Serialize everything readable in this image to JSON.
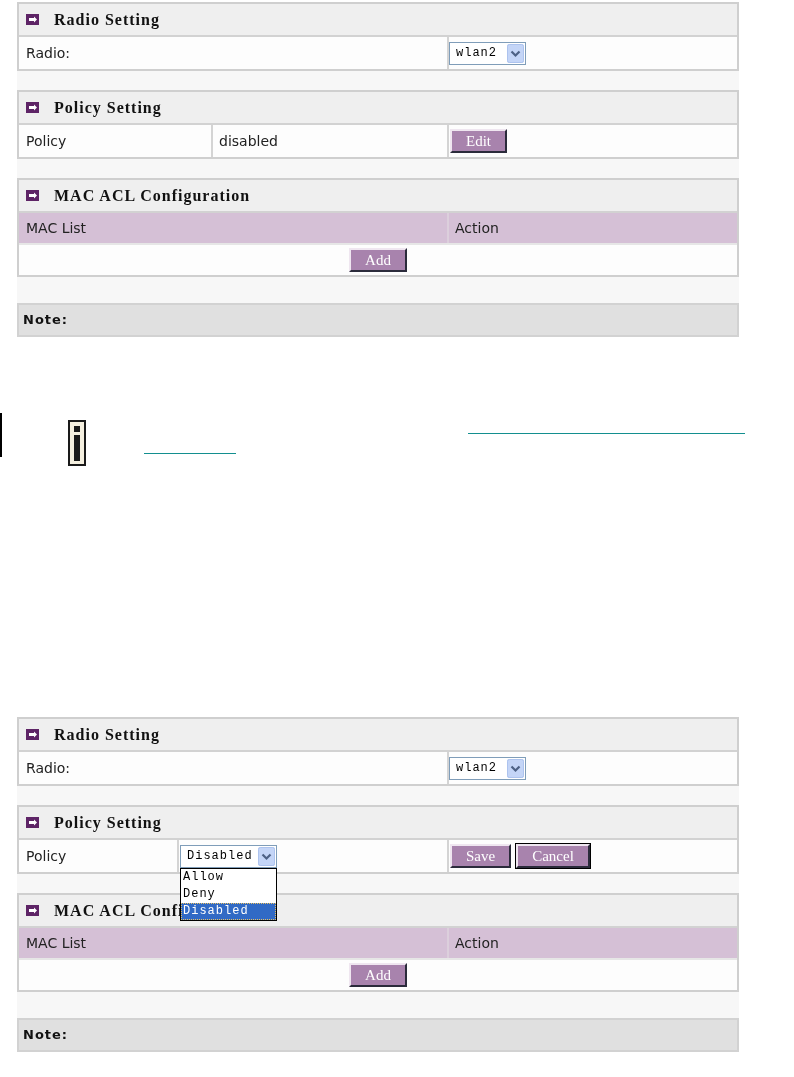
{
  "screens": [
    {
      "sections": [
        {
          "kind": "form",
          "title": "Radio Setting",
          "rows": [
            {
              "label": "Radio:",
              "control": {
                "kind": "select",
                "value": "wlan2",
                "expanded": false
              }
            }
          ]
        },
        {
          "kind": "form",
          "title": "Policy Setting",
          "rows": [
            {
              "label": "Policy",
              "control": {
                "kind": "text",
                "text": "disabled"
              },
              "buttons": [
                {
                  "label": "Edit",
                  "focused": false
                }
              ]
            }
          ]
        },
        {
          "kind": "table",
          "title": "MAC ACL Configuration",
          "columns": [
            "MAC List",
            "Action"
          ],
          "buttons": [
            {
              "label": "Add",
              "focused": false
            }
          ]
        },
        {
          "kind": "note",
          "title": "Note:"
        }
      ]
    },
    {
      "sections": [
        {
          "kind": "form",
          "title": "Radio Setting",
          "rows": [
            {
              "label": "Radio:",
              "control": {
                "kind": "select",
                "value": "wlan2",
                "expanded": false
              }
            }
          ]
        },
        {
          "kind": "form",
          "title": "Policy Setting",
          "rows": [
            {
              "label": "Policy",
              "control": {
                "kind": "select",
                "value": "Disabled",
                "expanded": true,
                "options": [
                  {
                    "label": "Allow",
                    "selected": false
                  },
                  {
                    "label": "Deny",
                    "selected": false
                  },
                  {
                    "label": "Disabled",
                    "selected": true
                  }
                ]
              },
              "buttons": [
                {
                  "label": "Save",
                  "focused": false
                },
                {
                  "label": "Cancel",
                  "focused": true
                }
              ]
            }
          ]
        },
        {
          "kind": "table",
          "title": "MAC ACL Confi",
          "columns": [
            "MAC List",
            "Action"
          ],
          "buttons": [
            {
              "label": "Add",
              "focused": false
            }
          ]
        },
        {
          "kind": "note",
          "title": "Note:"
        }
      ]
    }
  ]
}
